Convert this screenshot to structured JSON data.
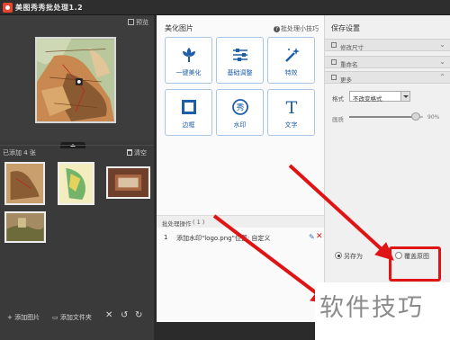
{
  "titlebar": {
    "title": "美图秀秀批处理1.2"
  },
  "left_panel": {
    "preview_label": "预览",
    "added_label": "已添加 4 张",
    "clear_label": "清空",
    "toolbar": {
      "add_image": "添加图片",
      "add_folder": "添加文件夹",
      "delete_icon": "delete-icon",
      "undo_icon": "rotate-left-icon",
      "redo_icon": "rotate-right-icon"
    }
  },
  "middle_panel": {
    "title": "美化图片",
    "tip": "批处理小技巧",
    "tools": [
      {
        "label": "一键美化",
        "icon": "flower-icon"
      },
      {
        "label": "基础调整",
        "icon": "sliders-icon"
      },
      {
        "label": "特效",
        "icon": "magic-wand-icon"
      },
      {
        "label": "边框",
        "icon": "frame-icon"
      },
      {
        "label": "水印",
        "icon": "watermark-icon"
      },
      {
        "label": "文字",
        "icon": "text-icon"
      }
    ],
    "batch_title": "批处理操作",
    "batch_count": "( 1 )",
    "operations": [
      {
        "num": "1",
        "text": "添加水印\"logo.png\"位置: 自定义"
      }
    ]
  },
  "right_panel": {
    "title": "保存设置",
    "sections": [
      "修改尺寸",
      "重命名",
      "更多"
    ],
    "format_label": "格式",
    "format_value": "不改变格式",
    "quality_label": "画质",
    "quality_value": "90%",
    "quality_level": 0.9,
    "save_as": "另存为",
    "overwrite": "覆盖原图"
  },
  "watermark": "软件技巧",
  "colors": {
    "accent_blue": "#1e5ea8",
    "arrow_red": "#e01414"
  }
}
